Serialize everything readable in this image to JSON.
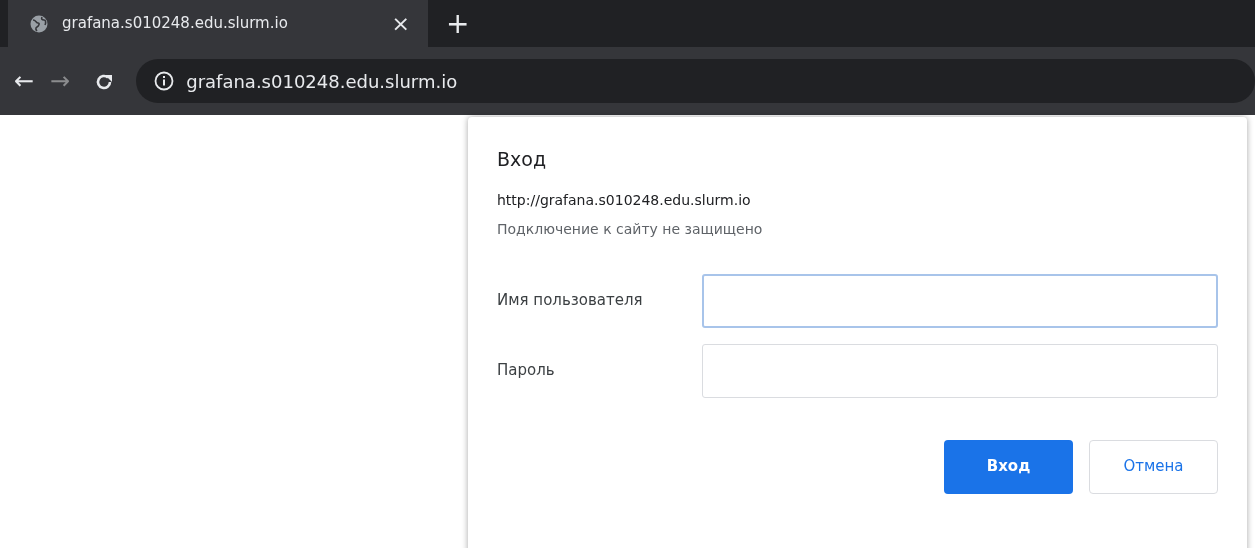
{
  "tabs": [
    {
      "title": "grafana.s010248.edu.slurm.io",
      "close": "×",
      "selected": true
    }
  ],
  "new_tab": "+",
  "toolbar": {
    "back": "←",
    "forward": "→",
    "forward_disabled": true,
    "address": "grafana.s010248.edu.slurm.io"
  },
  "dialog": {
    "title": "Вход",
    "origin": "http://grafana.s010248.edu.slurm.io",
    "warning": "Подключение к сайту не защищено",
    "fields": [
      {
        "label": "Имя пользователя",
        "focused": true
      },
      {
        "label": "Пароль",
        "focused": false
      }
    ],
    "buttons": [
      {
        "label": "Вход",
        "kind": "primary"
      },
      {
        "label": "Отмена",
        "kind": "secondary"
      }
    ]
  }
}
